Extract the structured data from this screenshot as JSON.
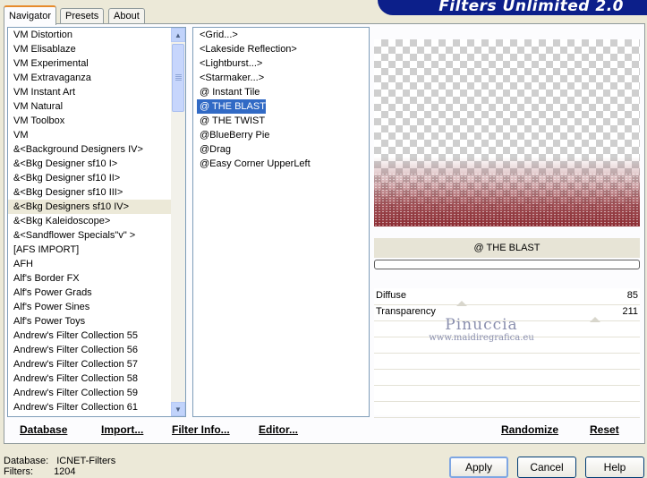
{
  "window": {
    "banner_title": "Filters Unlimited 2.0"
  },
  "tabs": [
    {
      "label": "Navigator",
      "active": true
    },
    {
      "label": "Presets",
      "active": false
    },
    {
      "label": "About",
      "active": false
    }
  ],
  "categories": [
    "VM Distortion",
    "VM Elisablaze",
    "VM Experimental",
    "VM Extravaganza",
    "VM Instant Art",
    "VM Natural",
    "VM Toolbox",
    "VM",
    "&<Background Designers IV>",
    "&<Bkg Designer sf10 I>",
    "&<Bkg Designer sf10 II>",
    "&<Bkg Designer sf10 III>",
    "&<Bkg Designers sf10 IV>",
    "&<Bkg Kaleidoscope>",
    "&<Sandflower Specials\"v\" >",
    "[AFS IMPORT]",
    "AFH",
    "Alf's Border FX",
    "Alf's Power Grads",
    "Alf's Power Sines",
    "Alf's Power Toys",
    "Andrew's Filter Collection 55",
    "Andrew's Filter Collection 56",
    "Andrew's Filter Collection 57",
    "Andrew's Filter Collection 58",
    "Andrew's Filter Collection 59",
    "Andrew's Filter Collection 61"
  ],
  "categories_current_index": 12,
  "filters": [
    "<Grid...>",
    "<Lakeside Reflection>",
    "<Lightburst...>",
    "<Starmaker...>",
    "@ Instant Tile",
    "@ THE BLAST",
    "@ THE TWIST",
    "@BlueBerry Pie",
    "@Drag",
    "@Easy Corner UpperLeft"
  ],
  "filters_selected_index": 5,
  "preview": {
    "filter_name": "@ THE BLAST"
  },
  "params": [
    {
      "label": "Diffuse",
      "value": "85",
      "level": 0.33
    },
    {
      "label": "Transparency",
      "value": "211",
      "level": 0.83
    }
  ],
  "watermark": {
    "name": "Pinuccia",
    "url": "www.maidiregrafica.eu"
  },
  "toolbar": {
    "database": "Database",
    "import": "Import...",
    "filter_info": "Filter Info...",
    "editor": "Editor...",
    "randomize": "Randomize",
    "reset": "Reset"
  },
  "buttons": {
    "apply": "Apply",
    "cancel": "Cancel",
    "help": "Help"
  },
  "status": {
    "database_label": "Database:",
    "database_value": "ICNET-Filters",
    "filters_label": "Filters:",
    "filters_value": "1204"
  },
  "colors": {
    "selection": "#316ac5",
    "banner": "#0c1f8a",
    "blast": "#8c2c33"
  }
}
